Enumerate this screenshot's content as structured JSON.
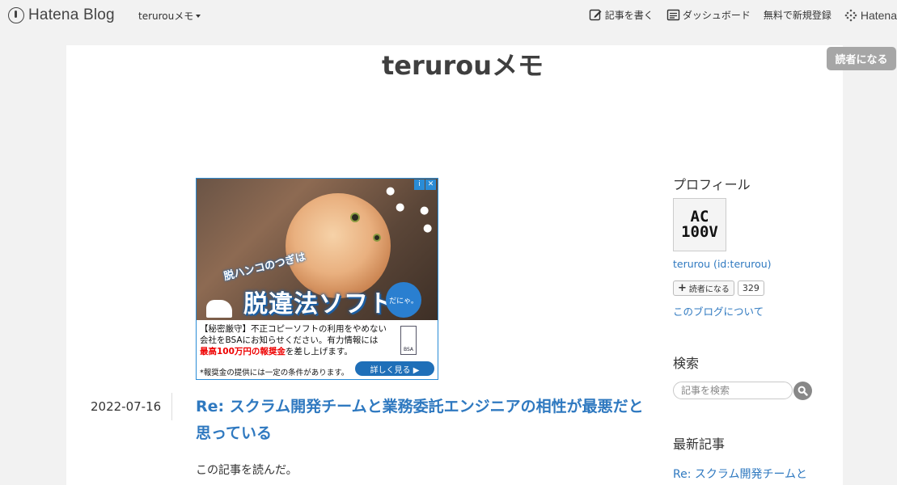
{
  "topbar": {
    "logo_text": "Hatena Blog",
    "blog_switch_label": "terurouメモ",
    "write_label": "記事を書く",
    "dashboard_label": "ダッシュボード",
    "signup_label": "無料で新規登録",
    "hatena_label": "Hatena"
  },
  "reader_button_label": "読者になる",
  "blog": {
    "title": "terurouメモ"
  },
  "ad": {
    "headline_small": "脱ハンコのつぎは",
    "headline_big": "脱違法ソフト",
    "bubble_text": "だにゃ。",
    "text_line1": "【秘密厳守】不正コピーソフトの利用をやめない",
    "text_line2": "会社をBSAにお知らせください。有力情報には",
    "text_line3_red": "最高100万円の報奨金",
    "text_line3_rest": "を差し上げます。",
    "note": "*報奨金の提供には一定の条件があります。",
    "cta_label": "詳しく見る ▶",
    "bsa_label": "BSA"
  },
  "post": {
    "date": "2022-07-16",
    "title": "Re: スクラム開発チームと業務委託エンジニアの相性が最悪だと思っている",
    "body_first_line": "この記事を読んだ。"
  },
  "sidebar": {
    "profile_heading": "プロフィール",
    "avatar_text_line1": "AC",
    "avatar_text_line2": "100V",
    "user_link": "terurou (id:terurou)",
    "subscribe_label": "読者になる",
    "subscriber_count": "329",
    "about_link": "このブログについて",
    "search_heading": "検索",
    "search_placeholder": "記事を検索",
    "recent_heading": "最新記事",
    "recent_first": "Re: スクラム開発チームと"
  },
  "colors": {
    "link": "#2f79c0",
    "reader_button_bg": "#a6a6a6"
  }
}
